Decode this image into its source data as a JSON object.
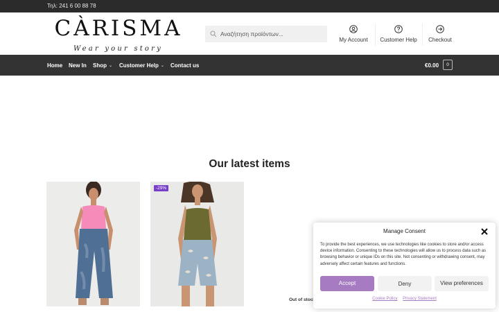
{
  "topbar": {
    "phone": "Τηλ: 241 6 00 88 78"
  },
  "logo": {
    "name": "CÀRISMA",
    "tagline": "Wear your story"
  },
  "search": {
    "placeholder": "Αναζήτηση προϊόντων...",
    "icon": "search-icon"
  },
  "header_links": [
    {
      "label": "My Account",
      "icon": "user-circle-icon"
    },
    {
      "label": "Customer Help",
      "icon": "help-circle-icon"
    },
    {
      "label": "Checkout",
      "icon": "arrow-circle-icon"
    }
  ],
  "nav": {
    "items": [
      {
        "label": "Home",
        "dropdown": false
      },
      {
        "label": "New In",
        "dropdown": false
      },
      {
        "label": "Shop",
        "dropdown": true
      },
      {
        "label": "Customer Help",
        "dropdown": true
      },
      {
        "label": "Contact us",
        "dropdown": false
      }
    ],
    "cart_total": "€0.00",
    "cart_count": "0"
  },
  "main": {
    "section_title": "Our latest items",
    "products": [
      {
        "badge": "",
        "status": ""
      },
      {
        "badge": "-29%",
        "status": ""
      },
      {
        "badge": "",
        "status": "Out of stock"
      }
    ]
  },
  "consent": {
    "title": "Manage Consent",
    "text": "To provide the best experiences, we use technologies like cookies to store and/or access device information. Consenting to these technologies will allow us to process data such as browsing behavior or unique IDs on this site. Not consenting or withdrawing consent, may adversely affect certain features and functions.",
    "accept": "Accept",
    "deny": "Deny",
    "preferences": "View preferences",
    "cookie_policy": "Cookie Policy",
    "privacy_statement": "Privacy Statement"
  },
  "colors": {
    "topbar": "#2b2b2b",
    "navbar": "#333333",
    "accent": "#a67bc1",
    "badge": "#7a3fc9"
  }
}
